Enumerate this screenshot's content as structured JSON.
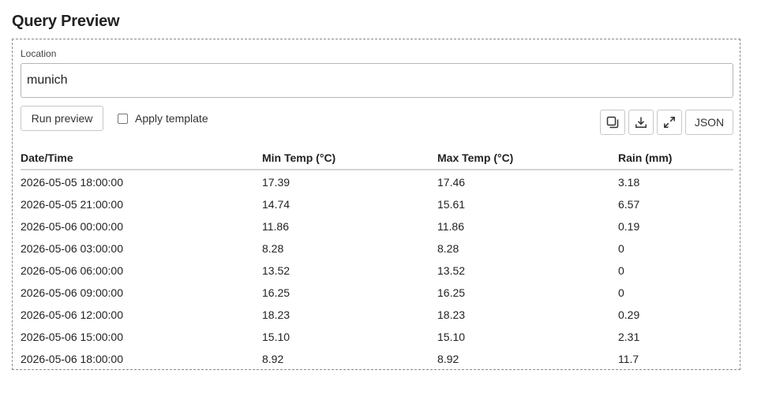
{
  "page": {
    "title": "Query Preview"
  },
  "location": {
    "label": "Location",
    "value": "munich"
  },
  "actions": {
    "run_label": "Run preview",
    "apply_template_label": "Apply template",
    "apply_template_checked": false,
    "copy_icon": "copy-icon",
    "download_icon": "download-icon",
    "expand_icon": "expand-icon",
    "json_label": "JSON"
  },
  "table": {
    "columns": [
      "Date/Time",
      "Min Temp (°C)",
      "Max Temp (°C)",
      "Rain (mm)"
    ],
    "rows": [
      [
        "2026-05-05 18:00:00",
        "17.39",
        "17.46",
        "3.18"
      ],
      [
        "2026-05-05 21:00:00",
        "14.74",
        "15.61",
        "6.57"
      ],
      [
        "2026-05-06 00:00:00",
        "11.86",
        "11.86",
        "0.19"
      ],
      [
        "2026-05-06 03:00:00",
        "8.28",
        "8.28",
        "0"
      ],
      [
        "2026-05-06 06:00:00",
        "13.52",
        "13.52",
        "0"
      ],
      [
        "2026-05-06 09:00:00",
        "16.25",
        "16.25",
        "0"
      ],
      [
        "2026-05-06 12:00:00",
        "18.23",
        "18.23",
        "0.29"
      ],
      [
        "2026-05-06 15:00:00",
        "15.10",
        "15.10",
        "2.31"
      ],
      [
        "2026-05-06 18:00:00",
        "8.92",
        "8.92",
        "11.7"
      ]
    ]
  }
}
